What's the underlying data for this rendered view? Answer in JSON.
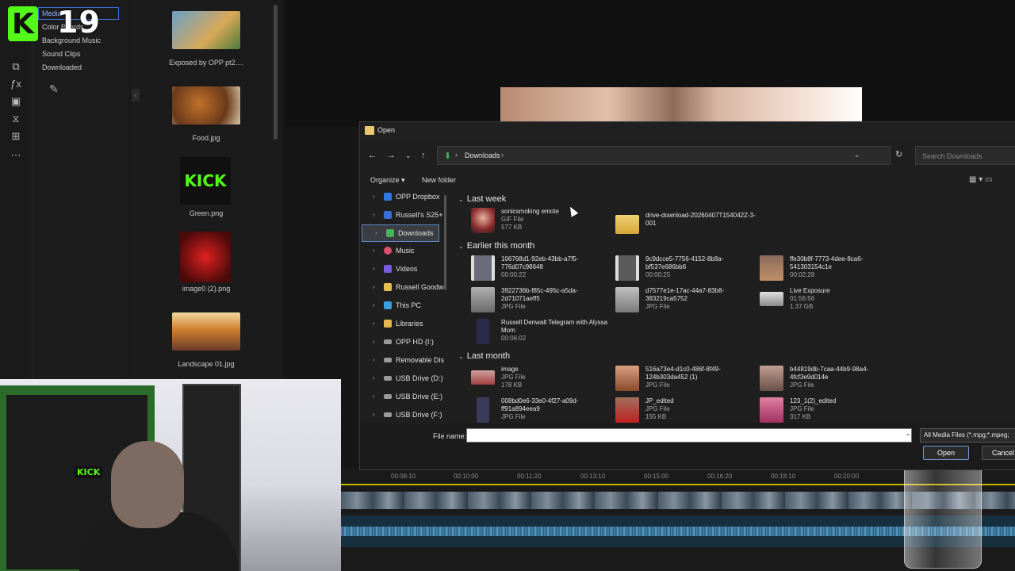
{
  "overlay": {
    "kick_number": "19",
    "kick_letter": "K"
  },
  "media_categories": [
    {
      "label": "Media",
      "selected": true
    },
    {
      "label": "Color Boards",
      "selected": false
    },
    {
      "label": "Background Music",
      "selected": false
    },
    {
      "label": "Sound Clips",
      "selected": false
    },
    {
      "label": "Downloaded",
      "selected": false
    }
  ],
  "thumbnails": [
    {
      "label": "Exposed by OPP pt2....",
      "color": "#6aa0c8"
    },
    {
      "label": "Food.jpg",
      "color": "#8a5a3a"
    },
    {
      "label": "Green.png",
      "color": "#111111"
    },
    {
      "label": "image0 (2).png",
      "color": "#b81818"
    },
    {
      "label": "Landscape 01.jpg",
      "color": "#c0843a"
    }
  ],
  "green_thumb_text": "KICK",
  "timeline_ticks": [
    "00:08:10",
    "00:10:00",
    "00:11:20",
    "00:13:10",
    "00:15:00",
    "00:16:20",
    "00:18:10",
    "00:20:00"
  ],
  "dialog": {
    "title": "Open",
    "address": "Downloads",
    "search_placeholder": "Search Downloads",
    "organize": "Organize",
    "new_folder": "New folder",
    "nav": [
      {
        "label": "OPP Dropbox",
        "color": "#2d7ae6",
        "selected": false
      },
      {
        "label": "Russell's S25+",
        "color": "#3a6fd8",
        "selected": false
      },
      {
        "label": "Downloads",
        "color": "#47b35a",
        "selected": true
      },
      {
        "label": "Music",
        "color": "#e0506e",
        "selected": false
      },
      {
        "label": "Videos",
        "color": "#7b5ae0",
        "selected": false
      },
      {
        "label": "Russell Goodw",
        "color": "#e8c050",
        "selected": false
      },
      {
        "label": "This PC",
        "color": "#3aa0e0",
        "selected": false
      },
      {
        "label": "Libraries",
        "color": "#e8b850",
        "selected": false
      },
      {
        "label": "OPP HD (I:)",
        "color": "#9a9a9a",
        "selected": false
      },
      {
        "label": "Removable Dis",
        "color": "#9a9a9a",
        "selected": false
      },
      {
        "label": "USB Drive (D:)",
        "color": "#9a9a9a",
        "selected": false
      },
      {
        "label": "USB Drive (E:)",
        "color": "#9a9a9a",
        "selected": false
      },
      {
        "label": "USB Drive (F:)",
        "color": "#9a9a9a",
        "selected": false
      }
    ],
    "groups": {
      "last_week": "Last week",
      "earlier_this_month": "Earlier this month",
      "last_month": "Last month"
    },
    "files_last_week": [
      {
        "name": "sonicsmoking emote",
        "meta1": "GIF File",
        "meta2": "577 KB",
        "color": "#8a2a2a"
      },
      {
        "name": "drive-download-20260407T154042Z-3-001",
        "meta1": "",
        "meta2": "",
        "color": "#e8c050"
      }
    ],
    "files_earlier": [
      {
        "name": "106768d1-92eb-43bb-a7f5-776d07c98648",
        "meta1": "00:00:22",
        "meta2": "",
        "color": "#6a6a7a"
      },
      {
        "name": "9c9dcce5-7756-4152-8b8a-bf537e686bb6",
        "meta1": "00:00:25",
        "meta2": "",
        "color": "#5a5a5a"
      },
      {
        "name": "ffe30b8f-7773-4dee-8ca6-541303154c1e",
        "meta1": "00:02:28",
        "meta2": "",
        "color": "#7a6a5a"
      },
      {
        "name": "3922736b-f85c-495c-a5da-2d71071aeff5",
        "meta1": "JPG File",
        "meta2": "",
        "color": "#8a8a8a"
      },
      {
        "name": "d7577e1e-17ac-44a7-83b8-383219ca5752",
        "meta1": "JPG File",
        "meta2": "",
        "color": "#9a9a9a"
      },
      {
        "name": "Live Exposure",
        "meta1": "01:56:56",
        "meta2": "1.37 GB",
        "color": "#cfcfcf"
      },
      {
        "name": "Russell Denwalt Telegram with Alyssa Mom",
        "meta1": "00:06:02",
        "meta2": "",
        "color": "#2a2a4a"
      }
    ],
    "files_last_month": [
      {
        "name": "image",
        "meta1": "JPG File",
        "meta2": "178 KB",
        "color": "#a04040"
      },
      {
        "name": "516a73e4-d1c0-486f-8f49-124b303da452 (1)",
        "meta1": "JPG File",
        "meta2": "",
        "color": "#b0704a"
      },
      {
        "name": "b44819db-7caa-44b9-98a4-4fcf3e9d014e",
        "meta1": "JPG File",
        "meta2": "",
        "color": "#9a8070"
      },
      {
        "name": "008bd0e6-33e0-4f27-a09d-ff91a894eea9",
        "meta1": "JPG File",
        "meta2": "",
        "color": "#3a3a5a"
      },
      {
        "name": "JP_edited",
        "meta1": "JPG File",
        "meta2": "155 KB",
        "color": "#b03030"
      },
      {
        "name": "123_1(2)_edited",
        "meta1": "JPG File",
        "meta2": "317 KB",
        "color": "#c05080"
      }
    ],
    "file_name_label": "File name:",
    "file_name_value": "",
    "filter": "All Media Files (*.mpg;*.mpeg;",
    "open_label": "Open",
    "cancel_label": "Cancel"
  }
}
